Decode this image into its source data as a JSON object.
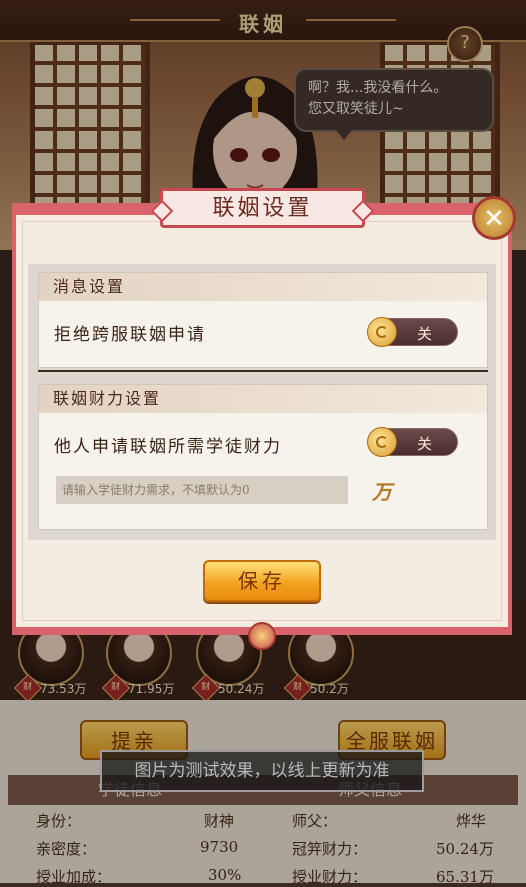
{
  "header": {
    "title": "联姻",
    "help_icon": "question-mark-icon"
  },
  "character": {
    "speech": "啊？我...我没看什么。\n您又取笑徒儿~"
  },
  "modal": {
    "title": "联姻设置",
    "close_icon": "close-icon",
    "message_section": {
      "heading": "消息设置",
      "row_label": "拒绝跨服联姻申请",
      "toggle_state": "关"
    },
    "wealth_section": {
      "heading": "联姻财力设置",
      "row_label": "他人申请联姻所需学徒财力",
      "toggle_state": "关",
      "input_placeholder": "请输入学徒财力需求，不填默认为0",
      "unit": "万"
    },
    "save_label": "保存"
  },
  "avatars": [
    {
      "tag": "财",
      "value": "73.53万"
    },
    {
      "tag": "财",
      "value": "71.95万"
    },
    {
      "tag": "财",
      "value": "50.24万"
    },
    {
      "tag": "财",
      "value": "50.2万"
    }
  ],
  "bottom": {
    "propose_label": "提亲",
    "server_marriage_label": "全服联姻",
    "strip_left": "学徒信息",
    "strip_right": "师父信息",
    "identity_label": "身份：",
    "identity_value": "财神",
    "master_label": "师父：",
    "master_value": "烨华",
    "intimacy_label": "亲密度：",
    "intimacy_value": "9730",
    "crown_wealth_label": "冠笄财力：",
    "crown_wealth_value": "50.24万",
    "teach_bonus_label": "授业加成：",
    "teach_bonus_value": "30%",
    "teach_wealth_label": "授业财力：",
    "teach_wealth_value": "65.31万"
  },
  "watermark": "图片为测试效果，以线上更新为准",
  "colors": {
    "modal_border": "#d8636b",
    "accent_gold": "#f2a01a",
    "title_red": "#c8484f"
  }
}
